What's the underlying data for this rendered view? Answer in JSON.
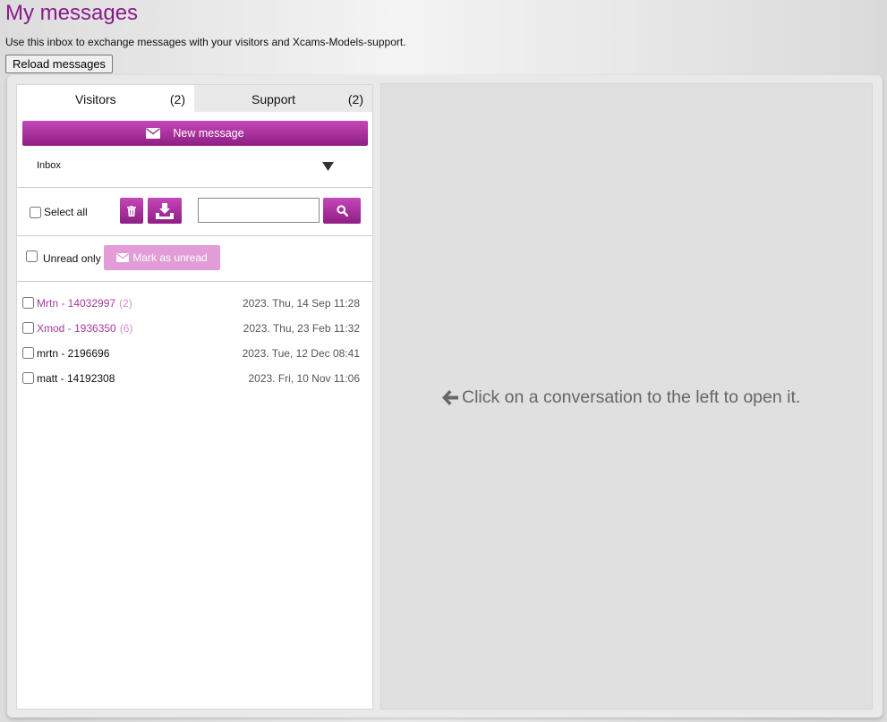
{
  "header": {
    "title": "My messages",
    "intro": "Use this inbox to exchange messages with your visitors and Xcams-Models-support.",
    "reload_label": "Reload messages"
  },
  "tabs": [
    {
      "label": "Visitors",
      "count": "(2)",
      "active": true
    },
    {
      "label": "Support",
      "count": "(2)",
      "active": false
    }
  ],
  "toolbar": {
    "new_message_label": "New message",
    "folder_selected": "Inbox",
    "select_all_label": "Select all",
    "delete_icon": "trash-icon",
    "download_icon": "download-icon",
    "search_placeholder": "",
    "search_icon": "search-icon",
    "unread_only_label": "Unread only",
    "mark_unread_label": "Mark as unread"
  },
  "messages": [
    {
      "name": "Mrtn - 14032997",
      "count": "(2)",
      "date": "2023. Thu, 14 Sep 11:28",
      "unread": true
    },
    {
      "name": "Xmod - 1936350",
      "count": "(6)",
      "date": "2023. Thu, 23 Feb 11:32",
      "unread": true
    },
    {
      "name": "mrtn - 2196696",
      "count": "",
      "date": "2023. Tue, 12 Dec 08:41",
      "unread": false
    },
    {
      "name": "matt - 14192308",
      "count": "",
      "date": "2023. Fri, 10 Nov 11:06",
      "unread": false
    }
  ],
  "conversation": {
    "placeholder": "Click on a conversation to the left to open it."
  },
  "colors": {
    "accent": "#a53b9a",
    "button_gradient_top": "#c547b8",
    "button_gradient_bottom": "#8e1e84",
    "title": "#8a1a8a",
    "disabled_button": "#e29cd8"
  }
}
